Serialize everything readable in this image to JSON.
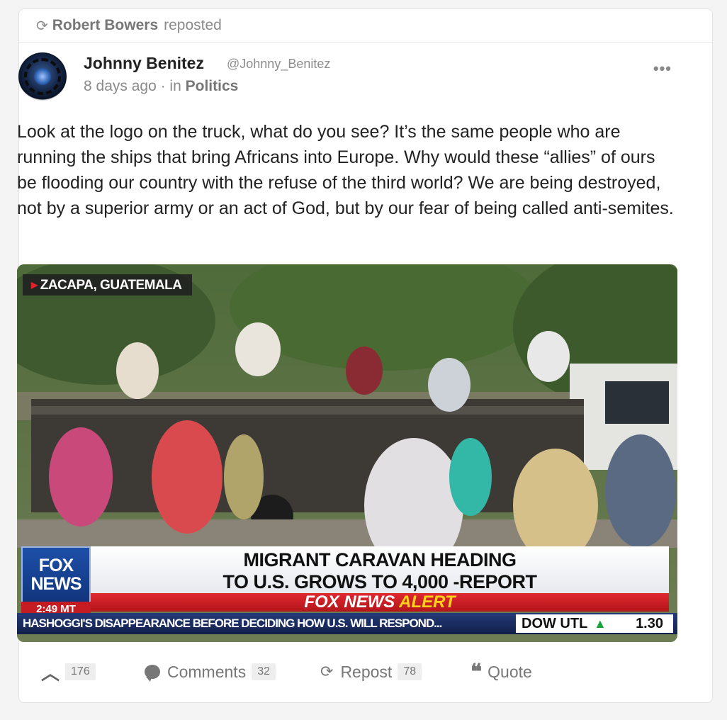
{
  "repost": {
    "user": "Robert Bowers",
    "action": "reposted"
  },
  "post": {
    "author_name": "Johnny Benitez",
    "author_handle": "@Johnny_Benitez",
    "time_prefix": "8 days ago · in",
    "category": "Politics",
    "more_label": "•••",
    "text": "Look at the logo on the truck, what do you see? It’s the same people who are running the ships that bring Africans into Europe. Why would these “allies” of ours be flooding our country with the refuse of the third world? We are being destroyed, not by a superior army or an act of God, but by our fear of being called anti-semites."
  },
  "media": {
    "location": "ZACAPA, GUATEMALA",
    "logo_line1": "FOX",
    "logo_line2": "NEWS",
    "time": "2:49 MT",
    "headline_line1": "MIGRANT CARAVAN HEADING",
    "headline_line2": "TO U.S. GROWS TO 4,000 -REPORT",
    "alert_brand": "FOX NEWS",
    "alert_word": "ALERT",
    "ticker": "HASHOGGI'S DISAPPEARANCE BEFORE DECIDING HOW U.S. WILL RESPOND...",
    "dow_label": "DOW UTL",
    "dow_value": "1.30"
  },
  "actions": {
    "upvote_count": "176",
    "comments_label": "Comments",
    "comments_count": "32",
    "repost_label": "Repost",
    "repost_count": "78",
    "quote_label": "Quote"
  }
}
